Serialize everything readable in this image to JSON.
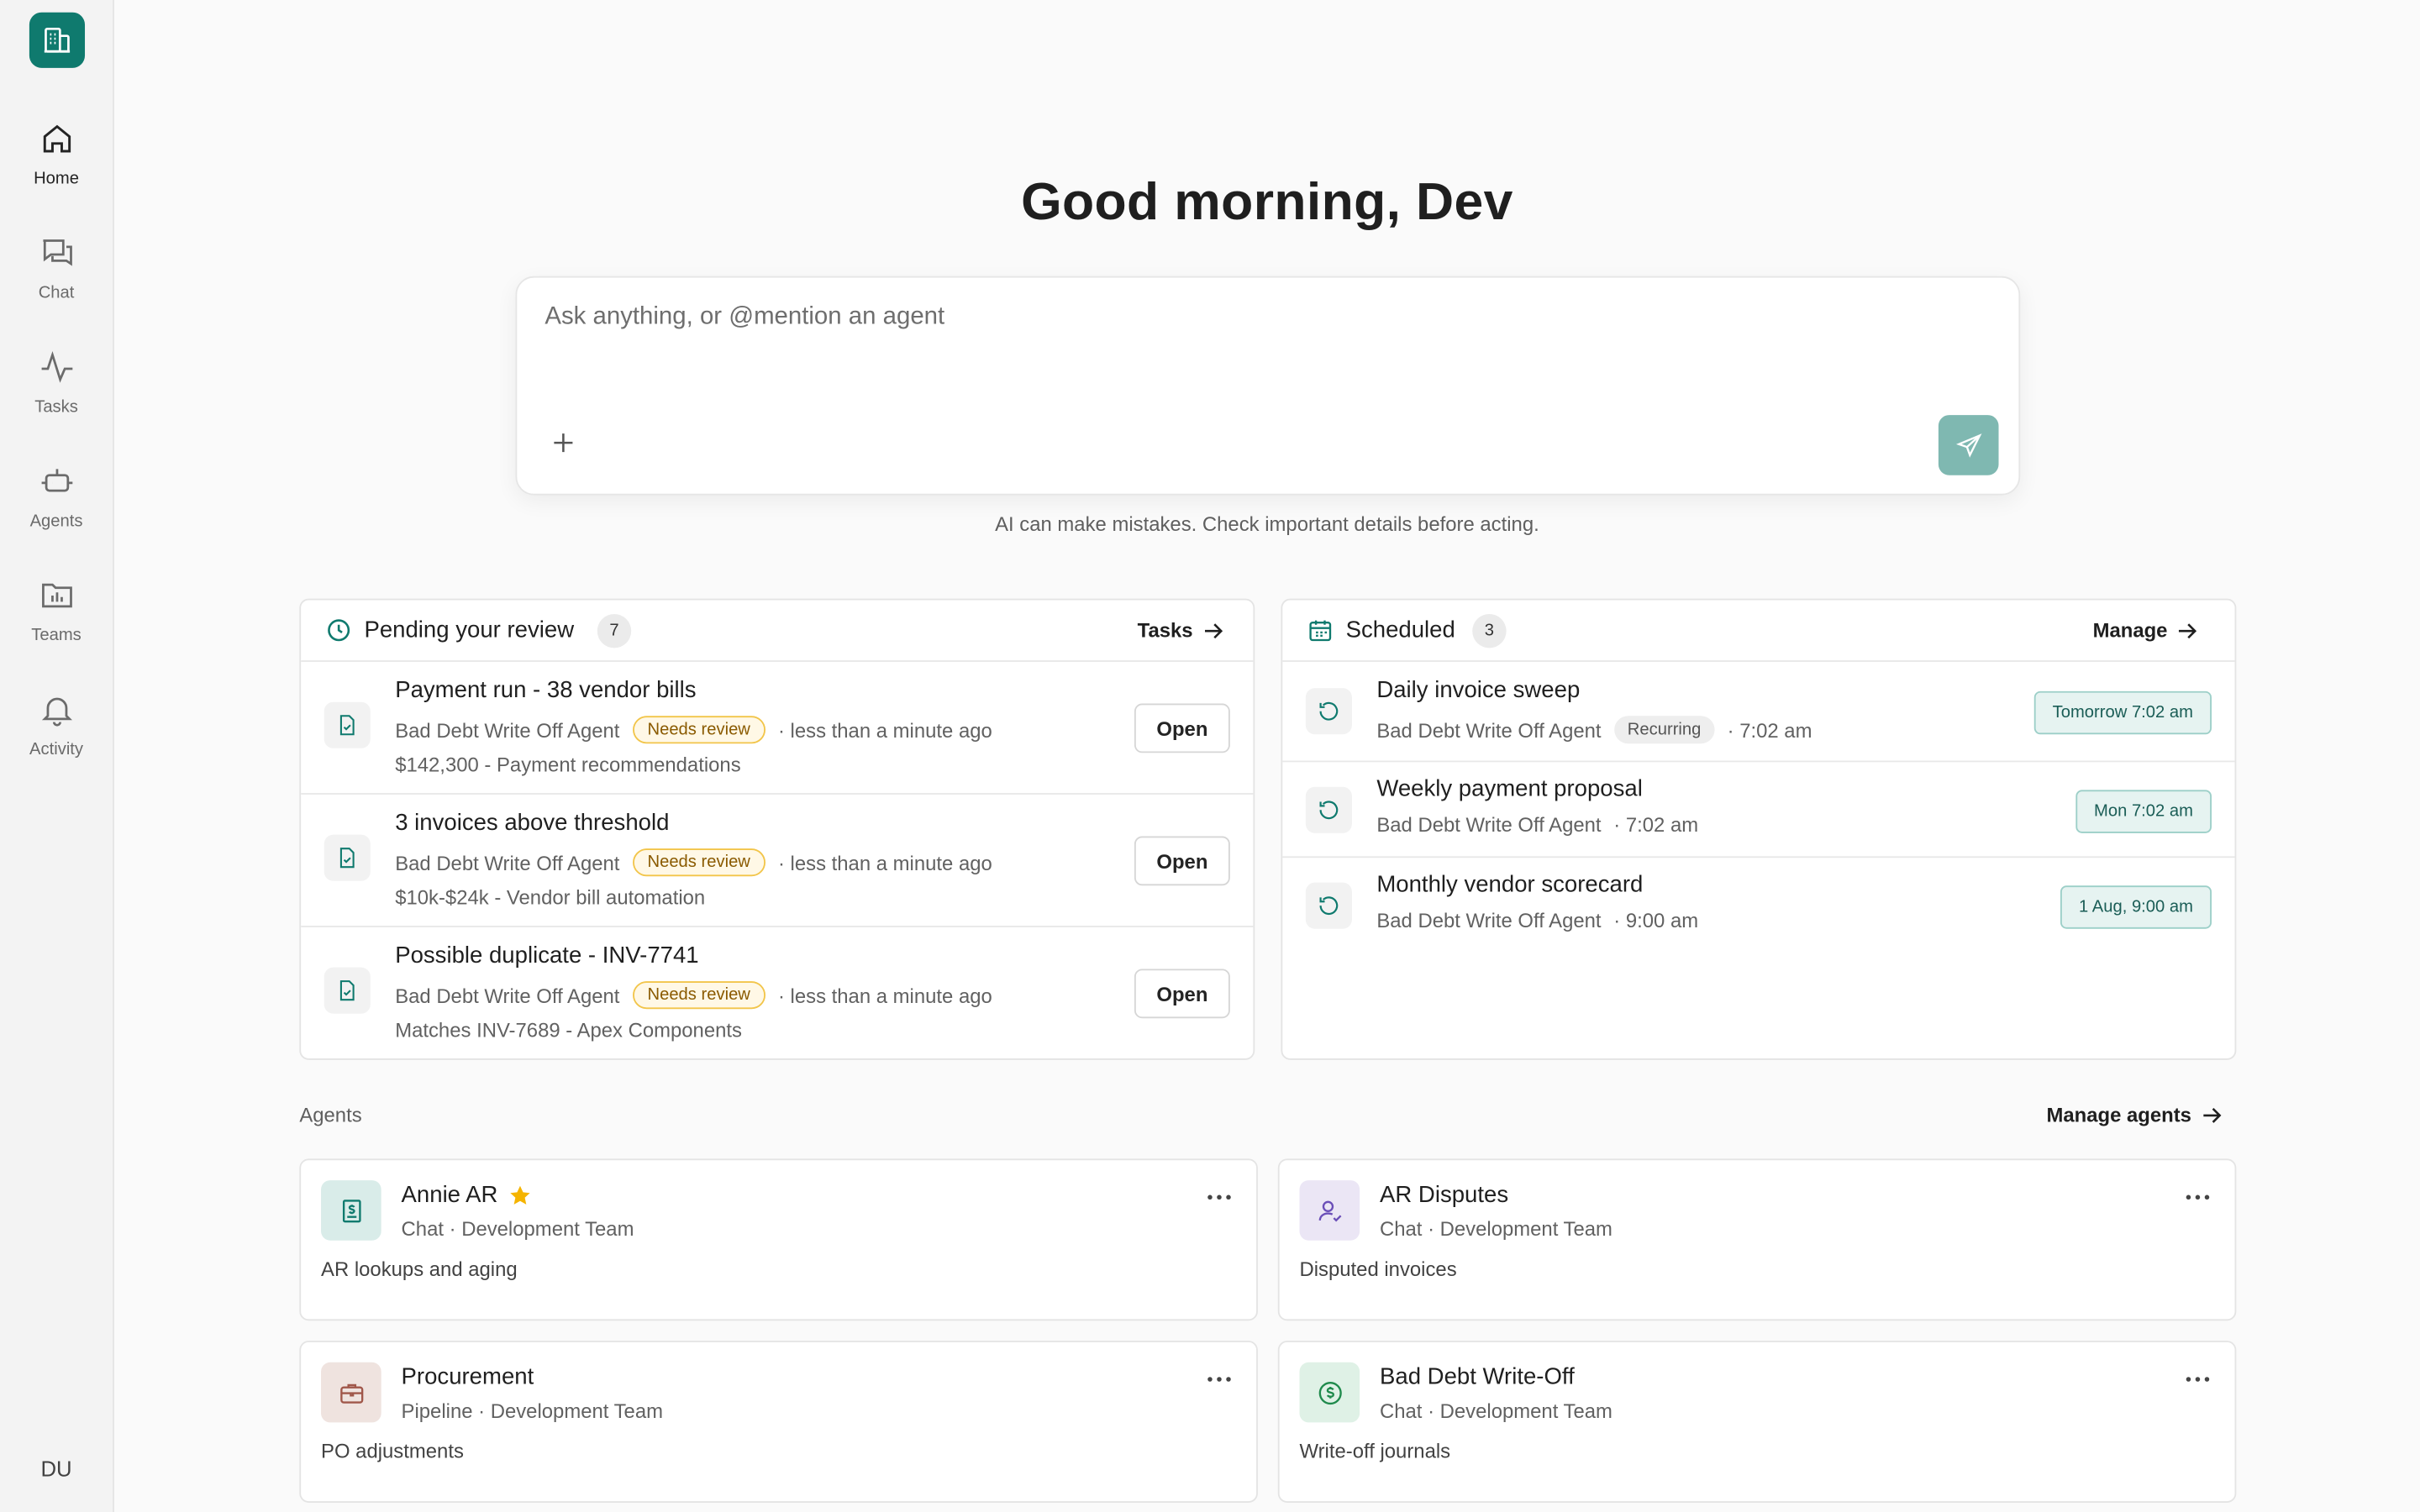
{
  "sidebar": {
    "logo_icon": "building-icon",
    "items": [
      {
        "label": "Home",
        "icon": "home-icon",
        "active": true
      },
      {
        "label": "Chat",
        "icon": "chat-icon"
      },
      {
        "label": "Tasks",
        "icon": "pulse-icon"
      },
      {
        "label": "Agents",
        "icon": "bot-icon"
      },
      {
        "label": "Teams",
        "icon": "folder-chart-icon"
      },
      {
        "label": "Activity",
        "icon": "bell-icon"
      }
    ],
    "user_initials": "DU"
  },
  "main": {
    "greeting": "Good morning, Dev",
    "prompt": {
      "placeholder": "Ask anything, or @mention an agent",
      "value": ""
    },
    "disclaimer": "AI can make mistakes. Check important details before acting."
  },
  "pending": {
    "title": "Pending your review",
    "count": "7",
    "link": "Tasks",
    "items": [
      {
        "title": "Payment run - 38 vendor bills",
        "agent": "Bad Debt Write Off Agent",
        "status": "Needs review",
        "time": "· less than a minute ago",
        "sub": "$142,300 - Payment recommendations",
        "action": "Open"
      },
      {
        "title": "3 invoices above threshold",
        "agent": "Bad Debt Write Off Agent",
        "status": "Needs review",
        "time": "· less than a minute ago",
        "sub": "$10k-$24k - Vendor bill automation",
        "action": "Open"
      },
      {
        "title": "Possible duplicate - INV-7741",
        "agent": "Bad Debt Write Off Agent",
        "status": "Needs review",
        "time": "· less than a minute ago",
        "sub": "Matches INV-7689 - Apex Components",
        "action": "Open"
      }
    ]
  },
  "scheduled": {
    "title": "Scheduled",
    "count": "3",
    "link": "Manage",
    "items": [
      {
        "title": "Daily invoice sweep",
        "agent": "Bad Debt Write Off Agent",
        "tag": "Recurring",
        "time": "· 7:02 am",
        "when": "Tomorrow 7:02 am"
      },
      {
        "title": "Weekly payment proposal",
        "agent": "Bad Debt Write Off Agent",
        "time": "· 7:02 am",
        "when": "Mon 7:02 am"
      },
      {
        "title": "Monthly vendor scorecard",
        "agent": "Bad Debt Write Off Agent",
        "time": "· 9:00 am",
        "when": "1 Aug, 9:00 am"
      }
    ]
  },
  "agents": {
    "label": "Agents",
    "manage_link": "Manage agents",
    "cards": [
      {
        "name": "Annie AR",
        "kind": "Chat · Development Team",
        "desc": "AR lookups and aging",
        "icon": "invoice-dollar-icon",
        "starred": true,
        "color": "#d9ece9"
      },
      {
        "name": "AR Disputes",
        "kind": "Chat · Development Team",
        "desc": "Disputed invoices",
        "icon": "person-check-icon",
        "color": "#ebe6f5"
      },
      {
        "name": "Procurement",
        "kind": "Pipeline · Development Team",
        "desc": "PO adjustments",
        "icon": "briefcase-icon",
        "color": "#efe3df"
      },
      {
        "name": "Bad Debt Write-Off",
        "kind": "Chat · Development Team",
        "desc": "Write-off journals",
        "icon": "dollar-circle-icon",
        "color": "#dff1e6"
      }
    ]
  },
  "colors": {
    "accent": "#0f7a6e",
    "send": "#7fb8b1",
    "review_badge": "#f2c54a"
  }
}
